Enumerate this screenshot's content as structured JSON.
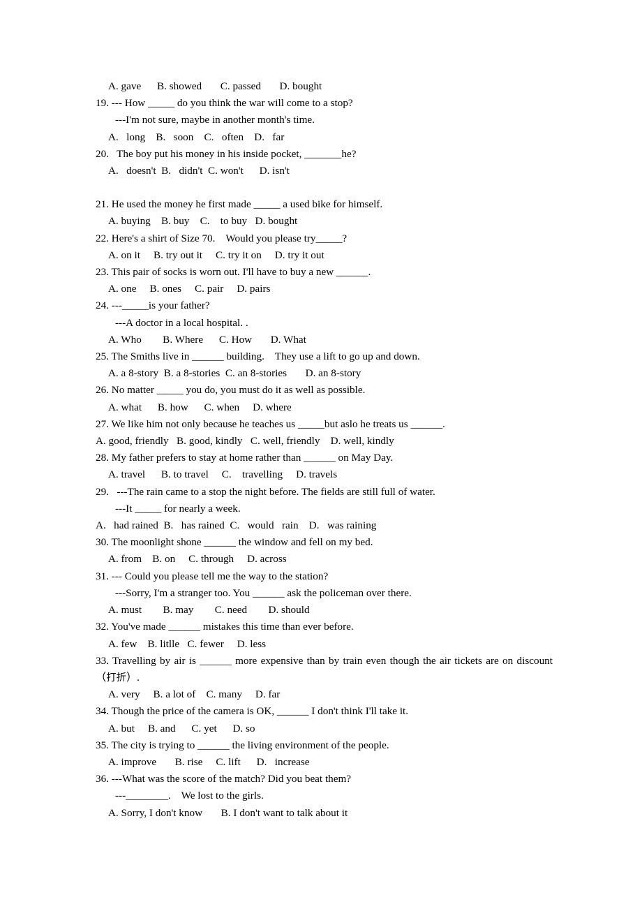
{
  "document": {
    "type": "multiple-choice-grammar-worksheet",
    "language": "English",
    "background_color": "#ffffff",
    "text_color": "#000000"
  },
  "blanks": {
    "short": "_____",
    "medium": "______",
    "long": "_______",
    "extra_long": "________"
  },
  "lines": {
    "q18_options": "A. gave      B. showed       C. passed       D. bought",
    "q19_stem": "19. --- How _____ do you think the war will come to a stop?",
    "q19_reply": "---I'm not sure, maybe in another month's time.",
    "q19_options": "A.   long    B.   soon    C.   often    D.   far",
    "q20_stem": "20.   The boy put his money in his inside pocket, _______he?",
    "q20_options": "A.   doesn't  B.   didn't  C. won't      D. isn't",
    "q21_stem": "21. He used the money he first made _____ a used bike for himself.",
    "q21_options": "A. buying    B. buy    C.    to buy   D. bought",
    "q22_stem": "22. Here's a shirt of Size 70.    Would you please try_____?",
    "q22_options": "A. on it     B. try out it     C. try it on     D. try it out",
    "q23_stem": "23. This pair of socks is worn out. I'll have to buy a new ______.",
    "q23_options": "A. one     B. ones     C. pair     D. pairs",
    "q24_stem": "24. ---_____is your father?",
    "q24_reply": "---A doctor in a local hospital. .",
    "q24_options": "A. Who        B. Where      C. How       D. What",
    "q25_stem": "25. The Smiths live in ______ building.    They use a lift to go up and down.",
    "q25_options": "A. a 8-story  B. a 8-stories  C. an 8-stories       D. an 8-story",
    "q26_stem": "26. No matter _____ you do, you must do it as well as possible.",
    "q26_options": "A. what      B. how      C. when     D. where",
    "q27_stem": "27. We like him not only because he teaches us _____but aslo he treats us ______.",
    "q27_options": "A. good, friendly   B. good, kindly   C. well, friendly    D. well, kindly",
    "q28_stem": "28. My father prefers to stay at home rather than ______ on May Day.",
    "q28_options": "A. travel      B. to travel     C.    travelling     D. travels",
    "q29_stem": "29.   ---The rain came to a stop the night before. The fields are still full of water.",
    "q29_reply": "---It _____ for nearly a week.",
    "q29_options": "A.   had rained  B.   has rained  C.   would   rain    D.   was raining",
    "q30_stem": "30. The moonlight shone ______ the window and fell on my bed.",
    "q30_options": "A. from    B. on     C. through     D. across",
    "q31_stem": "31. --- Could you please tell me the way to the station?",
    "q31_reply": "---Sorry, I'm a stranger too. You ______ ask the policeman over there.",
    "q31_options": "A. must        B. may        C. need        D. should",
    "q32_stem": "32. You've made ______ mistakes this time than ever before.",
    "q32_options": "A. few    B. litlle   C. fewer     D. less",
    "q33_stem": "33. Travelling by air is ______ more expensive than by train even though the air tickets are on discount（",
    "q33_cjk": "打折",
    "q33_stem_tail": "）.",
    "q33_options": "A. very     B. a lot of    C. many     D. far",
    "q34_stem": "34. Though the price of the camera is OK, ______ I don't think I'll take it.",
    "q34_options": "A. but     B. and      C. yet      D. so",
    "q35_stem": "35. The city is trying to ______ the living environment of the people.",
    "q35_options": "A. improve       B. rise     C. lift      D.   increase",
    "q36_stem": "36. ---What was the score of the match? Did you beat them?",
    "q36_reply": "---________.    We lost to the girls.",
    "q36_options": "A. Sorry, I don't know       B. I don't want to talk about it"
  }
}
